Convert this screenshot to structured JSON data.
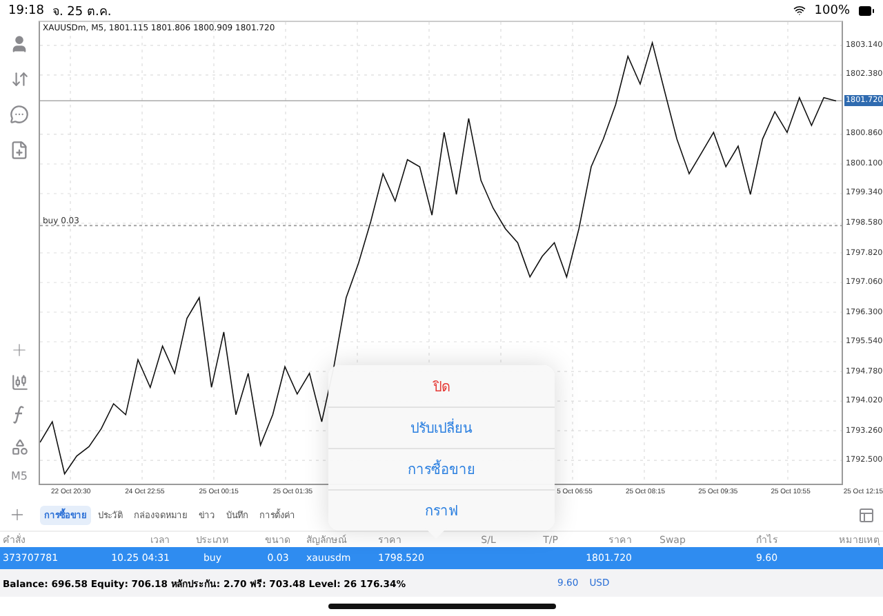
{
  "status_bar": {
    "time": "19:18",
    "date": "จ. 25 ต.ค.",
    "battery": "100%"
  },
  "chart": {
    "info": "XAUUSDm, M5, 1801.115 1801.806 1800.909 1801.720",
    "timeframe": "M5",
    "x_labels_left": [
      "22 Oct 20:30",
      "24 Oct 22:55",
      "25 Oct 00:15",
      "25 Oct 01:35"
    ],
    "x_labels_right": [
      "5 Oct 06:55",
      "25 Oct 08:15",
      "25 Oct 09:35",
      "25 Oct 10:55",
      "25 Oct 12:15"
    ],
    "chart_data": {
      "type": "line",
      "grid": true,
      "ylim": [
        1791.9,
        1803.74
      ],
      "yticks": [
        {
          "value": 1803.14,
          "label": "1803.140"
        },
        {
          "value": 1802.38,
          "label": "1802.380"
        },
        {
          "value": 1800.86,
          "label": "1800.860"
        },
        {
          "value": 1800.1,
          "label": "1800.100"
        },
        {
          "value": 1799.34,
          "label": "1799.340"
        },
        {
          "value": 1798.58,
          "label": "1798.580"
        },
        {
          "value": 1797.82,
          "label": "1797.820"
        },
        {
          "value": 1797.06,
          "label": "1797.060"
        },
        {
          "value": 1796.3,
          "label": "1796.300"
        },
        {
          "value": 1795.54,
          "label": "1795.540"
        },
        {
          "value": 1794.78,
          "label": "1794.780"
        },
        {
          "value": 1794.02,
          "label": "1794.020"
        },
        {
          "value": 1793.26,
          "label": "1793.260"
        },
        {
          "value": 1792.5,
          "label": "1792.500"
        }
      ],
      "ref_lines": [
        {
          "axis": "y",
          "value": 1801.72,
          "label": "1801.720",
          "color": "#aaaaaa"
        },
        {
          "axis": "y",
          "value": 1798.52,
          "label": "buy 0.03",
          "color": "#999999"
        }
      ],
      "series": [
        {
          "color": "#111111",
          "values": [
            1792.96,
            1793.49,
            1792.15,
            1792.61,
            1792.85,
            1793.31,
            1793.95,
            1793.67,
            1795.08,
            1794.37,
            1795.43,
            1794.73,
            1796.14,
            1796.67,
            1794.37,
            1795.79,
            1793.67,
            1794.73,
            1792.89,
            1793.67,
            1794.9,
            1794.2,
            1794.73,
            1793.49,
            1794.9,
            1796.67,
            1797.55,
            1798.62,
            1799.85,
            1799.15,
            1800.21,
            1800.03,
            1798.79,
            1800.91,
            1799.32,
            1801.27,
            1799.68,
            1798.97,
            1798.44,
            1798.08,
            1797.2,
            1797.73,
            1798.08,
            1797.2,
            1798.44,
            1800.03,
            1800.74,
            1801.62,
            1802.86,
            1802.15,
            1803.21,
            1801.97,
            1800.74,
            1799.85,
            1800.38,
            1800.91,
            1800.03,
            1800.56,
            1799.32,
            1800.74,
            1801.44,
            1800.91,
            1801.8,
            1801.09,
            1801.8,
            1801.72
          ]
        }
      ]
    }
  },
  "tabs": [
    {
      "label": "การซื้อขาย",
      "selected": true
    },
    {
      "label": "ประวัติ",
      "selected": false
    },
    {
      "label": "กล่องจดหมาย",
      "selected": false
    },
    {
      "label": "ข่าว",
      "selected": false
    },
    {
      "label": "บันทึก",
      "selected": false
    },
    {
      "label": "การตั้งค่า",
      "selected": false
    }
  ],
  "table": {
    "columns": [
      "คำสั่ง",
      "เวลา",
      "ประเภท",
      "ขนาด",
      "สัญลักษณ์",
      "ราคา",
      "S/L",
      "T/P",
      "ราคา",
      "Swap",
      "กำไร",
      "หมายเหตุ"
    ],
    "rows": [
      {
        "selected": true,
        "cells": [
          "373707781",
          "10.25 04:31",
          "buy",
          "0.03",
          "xauusdm",
          "1798.520",
          "",
          "",
          "1801.720",
          "",
          "9.60",
          ""
        ]
      }
    ]
  },
  "summary": {
    "text": "Balance: 696.58 Equity: 706.18 หลักประกัน: 2.70 ฟรี: 703.48 Level: 26 176.34%",
    "profit": "9.60",
    "currency": "USD"
  },
  "popup_menu": [
    {
      "label": "ปิด",
      "kind": "destructive"
    },
    {
      "label": "ปรับเปลี่ยน",
      "kind": "normal"
    },
    {
      "label": "การซื้อขาย",
      "kind": "normal"
    },
    {
      "label": "กราฟ",
      "kind": "normal"
    }
  ]
}
